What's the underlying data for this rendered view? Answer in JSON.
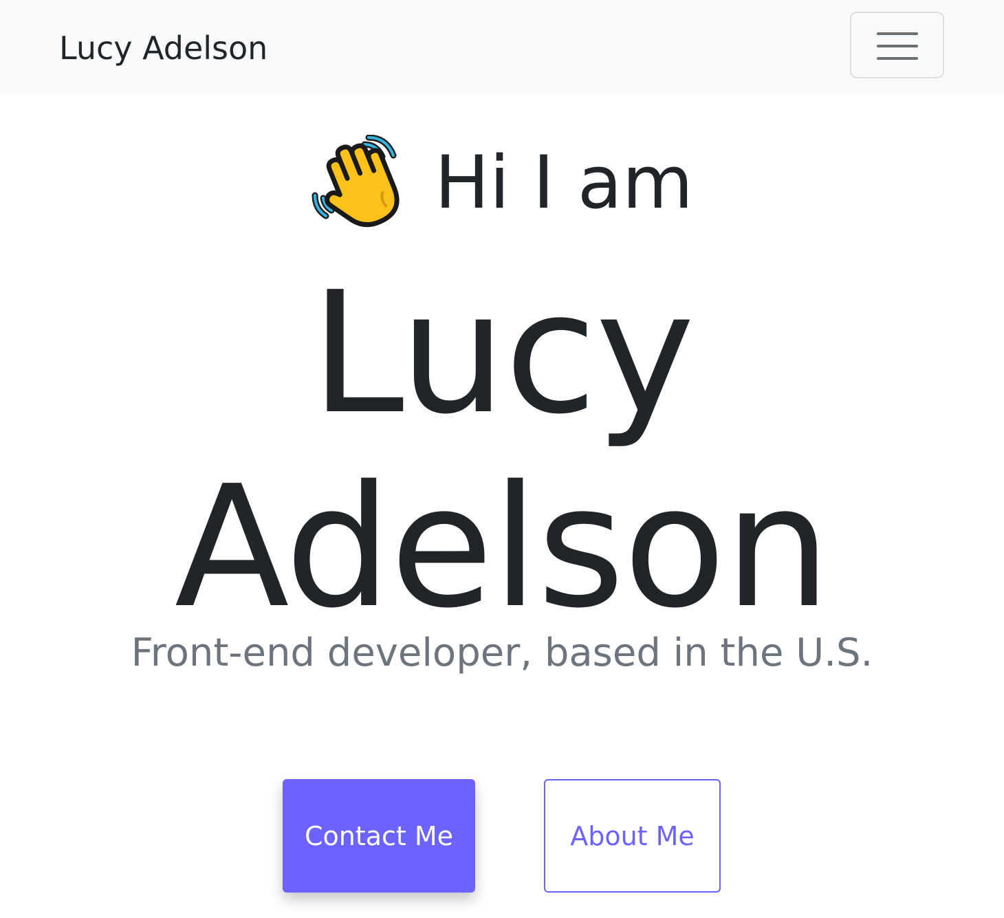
{
  "navbar": {
    "brand": "Lucy Adelson",
    "toggler_icon": "hamburger-menu-icon"
  },
  "hero": {
    "wave_icon": "waving-hand-icon",
    "greeting": "Hi I am",
    "name_first": "Lucy",
    "name_last": "Adelson",
    "subtitle": "Front-end developer, based in the U.S."
  },
  "buttons": {
    "contact_label": "Contact Me",
    "about_label": "About Me"
  },
  "colors": {
    "navbar_bg": "#f8f9fa",
    "text_dark": "#212529",
    "text_muted": "#6c757d",
    "accent": "#6c63ff"
  }
}
